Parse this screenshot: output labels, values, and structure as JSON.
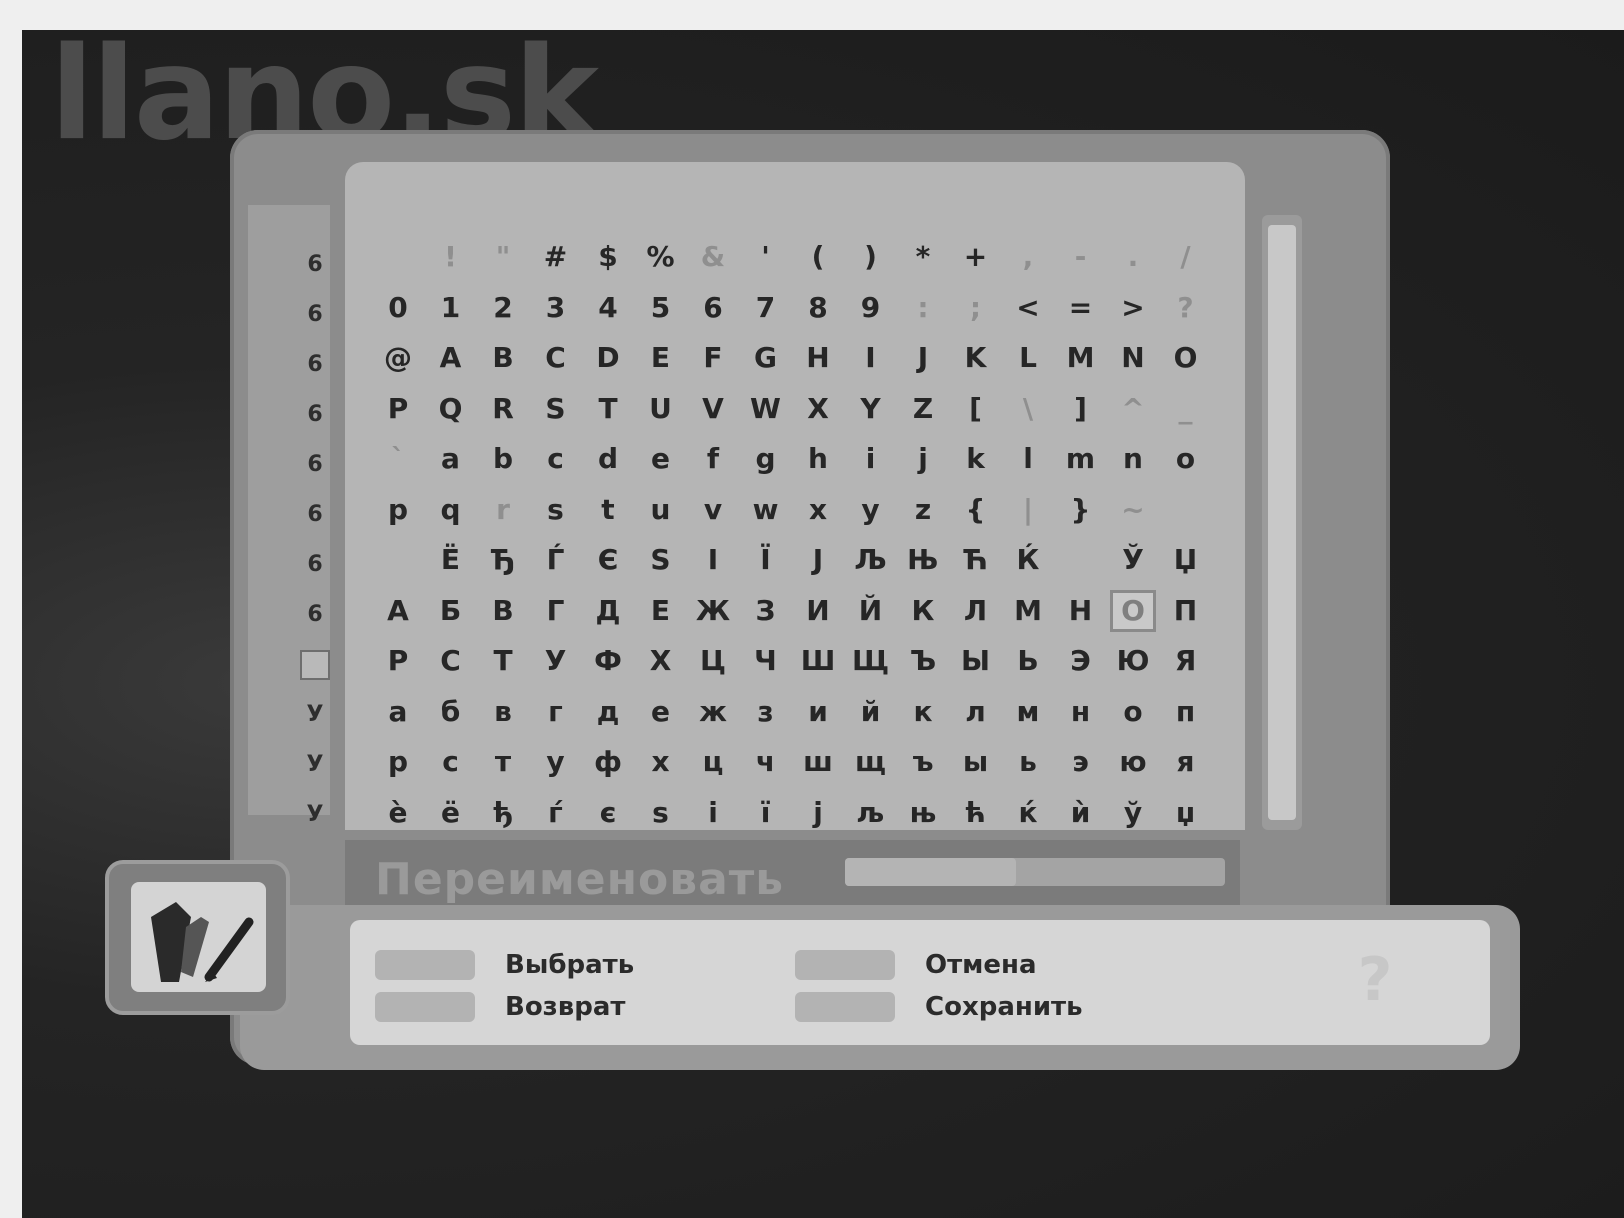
{
  "watermark": "llano.sk",
  "row_markers": [
    {
      "label": "6",
      "selected": false
    },
    {
      "label": "6",
      "selected": false
    },
    {
      "label": "6",
      "selected": false
    },
    {
      "label": "6",
      "selected": false
    },
    {
      "label": "6",
      "selected": false
    },
    {
      "label": "6",
      "selected": false
    },
    {
      "label": "6",
      "selected": false
    },
    {
      "label": "6",
      "selected": false
    },
    {
      "label": "",
      "selected": true
    },
    {
      "label": "У",
      "selected": false
    },
    {
      "label": "У",
      "selected": false
    },
    {
      "label": "У",
      "selected": false
    }
  ],
  "char_grid": [
    [
      " ",
      "!",
      "\"",
      "#",
      "$",
      "%",
      "&",
      "'",
      "(",
      ")",
      "*",
      "+",
      ",",
      "-",
      ".",
      "/"
    ],
    [
      "0",
      "1",
      "2",
      "3",
      "4",
      "5",
      "6",
      "7",
      "8",
      "9",
      ":",
      ";",
      "<",
      "=",
      ">",
      "?"
    ],
    [
      "@",
      "A",
      "B",
      "C",
      "D",
      "E",
      "F",
      "G",
      "H",
      "I",
      "J",
      "K",
      "L",
      "M",
      "N",
      "O"
    ],
    [
      "P",
      "Q",
      "R",
      "S",
      "T",
      "U",
      "V",
      "W",
      "X",
      "Y",
      "Z",
      "[",
      "\\",
      "]",
      "^",
      "_"
    ],
    [
      "`",
      "a",
      "b",
      "c",
      "d",
      "e",
      "f",
      "g",
      "h",
      "i",
      "j",
      "k",
      "l",
      "m",
      "n",
      "o"
    ],
    [
      "p",
      "q",
      "r",
      "s",
      "t",
      "u",
      "v",
      "w",
      "x",
      "y",
      "z",
      "{",
      "|",
      "}",
      "~",
      " "
    ],
    [
      " ",
      "Ё",
      "Ђ",
      "Ѓ",
      "Є",
      "Ѕ",
      "І",
      "Ї",
      "Ј",
      "Љ",
      "Њ",
      "Ћ",
      "Ќ",
      " ",
      "Ў",
      "Џ"
    ],
    [
      "А",
      "Б",
      "В",
      "Г",
      "Д",
      "Е",
      "Ж",
      "З",
      "И",
      "Й",
      "К",
      "Л",
      "М",
      "Н",
      "О",
      "П"
    ],
    [
      "Р",
      "С",
      "Т",
      "У",
      "Ф",
      "Х",
      "Ц",
      "Ч",
      "Ш",
      "Щ",
      "Ъ",
      "Ы",
      "Ь",
      "Э",
      "Ю",
      "Я"
    ],
    [
      "а",
      "б",
      "в",
      "г",
      "д",
      "е",
      "ж",
      "з",
      "и",
      "й",
      "к",
      "л",
      "м",
      "н",
      "о",
      "п"
    ],
    [
      "р",
      "с",
      "т",
      "у",
      "ф",
      "х",
      "ц",
      "ч",
      "ш",
      "щ",
      "ъ",
      "ы",
      "ь",
      "э",
      "ю",
      "я"
    ],
    [
      "ѐ",
      "ё",
      "ђ",
      "ѓ",
      "є",
      "ѕ",
      "і",
      "ї",
      "ј",
      "љ",
      "њ",
      "ћ",
      "ќ",
      "ѝ",
      "ў",
      "џ"
    ]
  ],
  "faint_cells": [
    "0,1",
    "0,2",
    "0,6",
    "0,12",
    "0,13",
    "0,14",
    "0,15",
    "1,10",
    "1,11",
    "1,15",
    "3,12",
    "3,14",
    "3,15",
    "4,0",
    "5,2",
    "5,12",
    "5,14"
  ],
  "selected_cell": "7,14",
  "name_field": "Переименовать",
  "name_meter_fill": 0.45,
  "buttons": {
    "select": "Выбрать",
    "back": "Возврат",
    "cancel": "Отмена",
    "save": "Сохранить"
  },
  "help_icon": "?"
}
